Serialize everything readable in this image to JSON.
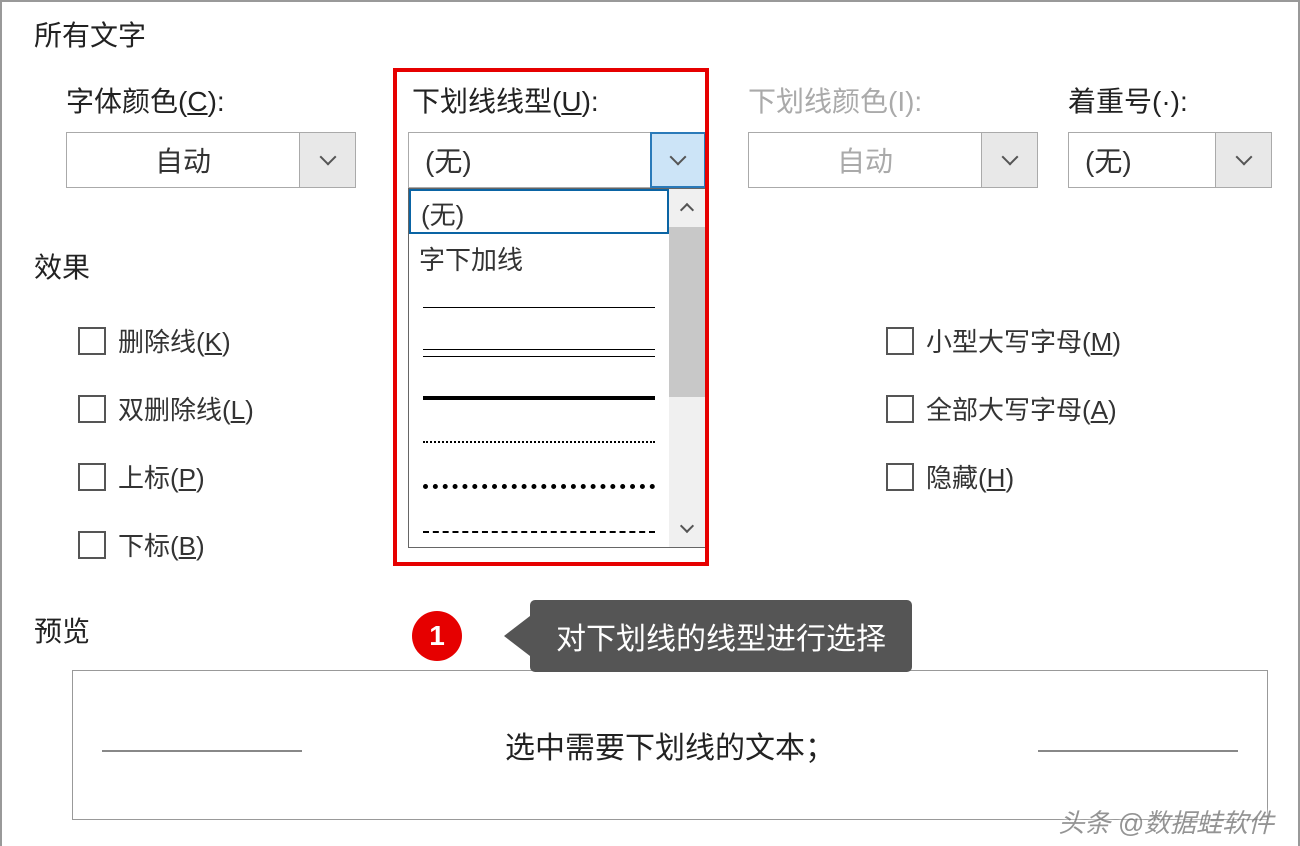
{
  "section": {
    "all_text": "所有文字",
    "effects": "效果",
    "preview": "预览"
  },
  "labels": {
    "font_color_pre": "字体颜色(",
    "font_color_acc": "C",
    "font_color_post": "):",
    "underline_style_pre": "下划线线型(",
    "underline_style_acc": "U",
    "underline_style_post": "):",
    "underline_color": "下划线颜色(I):",
    "emphasis": "着重号(·):"
  },
  "dropdowns": {
    "font_color": "自动",
    "underline_style": "(无)",
    "underline_color": "自动",
    "emphasis": "(无)"
  },
  "underline_list": {
    "item0": "(无)",
    "item1": "字下加线"
  },
  "checkboxes": {
    "strike_pre": "删除线(",
    "strike_acc": "K",
    "strike_post": ")",
    "dstrike_pre": "双删除线(",
    "dstrike_acc": "L",
    "dstrike_post": ")",
    "super_pre": "上标(",
    "super_acc": "P",
    "super_post": ")",
    "sub_pre": "下标(",
    "sub_acc": "B",
    "sub_post": ")",
    "smallcaps_pre": "小型大写字母(",
    "smallcaps_acc": "M",
    "smallcaps_post": ")",
    "allcaps_pre": "全部大写字母(",
    "allcaps_acc": "A",
    "allcaps_post": ")",
    "hidden_pre": "隐藏(",
    "hidden_acc": "H",
    "hidden_post": ")"
  },
  "preview_text": "选中需要下划线的文本；",
  "annotation": {
    "number": "1",
    "text": "对下划线的线型进行选择"
  },
  "watermark": "头条 @数据蛙软件"
}
